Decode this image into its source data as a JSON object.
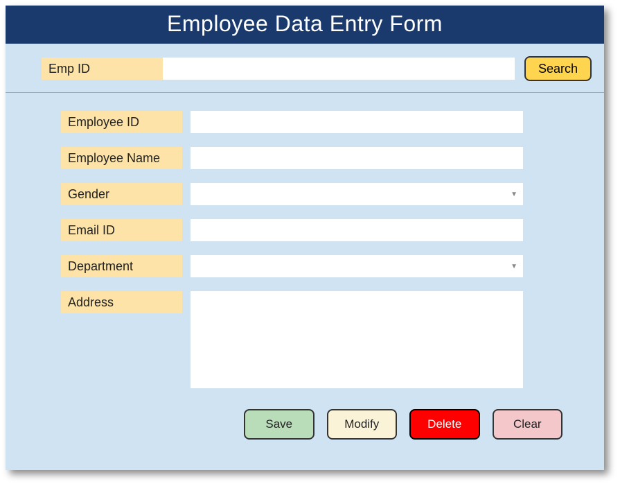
{
  "header": {
    "title": "Employee Data Entry Form"
  },
  "search": {
    "label": "Emp ID",
    "value": "",
    "button_label": "Search"
  },
  "fields": {
    "employee_id": {
      "label": "Employee ID",
      "value": ""
    },
    "employee_name": {
      "label": "Employee Name",
      "value": ""
    },
    "gender": {
      "label": "Gender",
      "value": ""
    },
    "email_id": {
      "label": "Email ID",
      "value": ""
    },
    "department": {
      "label": "Department",
      "value": ""
    },
    "address": {
      "label": "Address",
      "value": ""
    }
  },
  "buttons": {
    "save": "Save",
    "modify": "Modify",
    "delete": "Delete",
    "clear": "Clear"
  }
}
